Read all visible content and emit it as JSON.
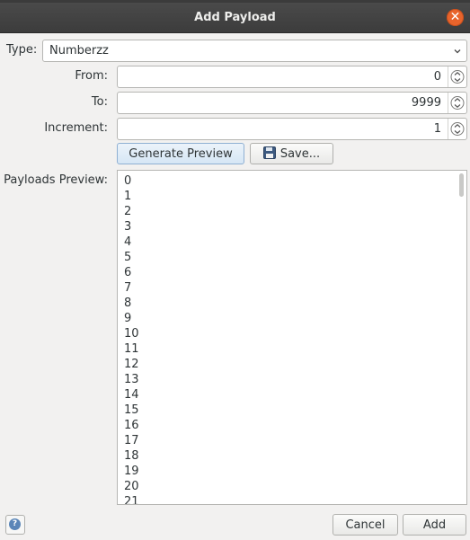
{
  "window": {
    "title": "Add Payload"
  },
  "form": {
    "type_label": "Type:",
    "type_value": "Numberzz",
    "from_label": "From:",
    "from_value": "0",
    "to_label": "To:",
    "to_value": "9999",
    "increment_label": "Increment:",
    "increment_value": "1",
    "preview_label": "Payloads Preview:"
  },
  "actions": {
    "generate_label": "Generate Preview",
    "save_label": "Save..."
  },
  "preview_items": [
    "0",
    "1",
    "2",
    "3",
    "4",
    "5",
    "6",
    "7",
    "8",
    "9",
    "10",
    "11",
    "12",
    "13",
    "14",
    "15",
    "16",
    "17",
    "18",
    "19",
    "20",
    "21"
  ],
  "footer": {
    "cancel_label": "Cancel",
    "add_label": "Add"
  },
  "icons": {
    "close": "close-icon",
    "help": "help-icon",
    "save": "floppy-disk-icon",
    "dropdown": "chevron-down-icon",
    "spinner": "spinner-arrows-icon"
  }
}
